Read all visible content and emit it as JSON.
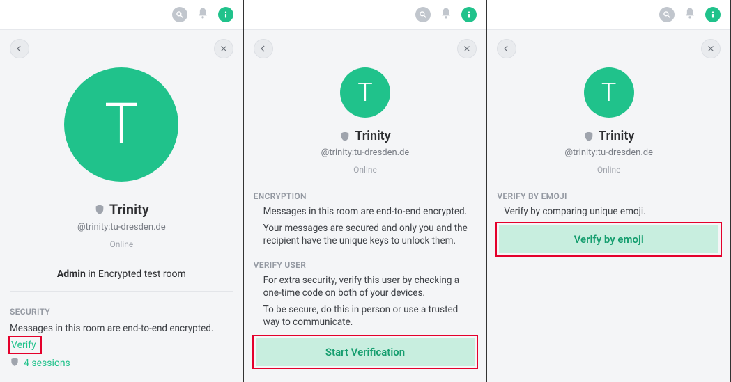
{
  "common": {
    "avatar_letter": "T",
    "display_name": "Trinity",
    "handle": "@trinity:tu-dresden.de",
    "status": "Online"
  },
  "panel1": {
    "role_strong": "Admin",
    "role_rest": " in Encrypted test room",
    "security_label": "SECURITY",
    "encrypted_msg": "Messages in this room are end-to-end encrypted.",
    "verify_link": "Verify",
    "sessions_link": "4 sessions"
  },
  "panel2": {
    "encryption_label": "ENCRYPTION",
    "encryption_text1": "Messages in this room are end-to-end encrypted.",
    "encryption_text2": "Your messages are secured and only you and the recipient have the unique keys to unlock them.",
    "verify_user_label": "VERIFY USER",
    "verify_user_text1": "For extra security, verify this user by checking a one-time code on both of your devices.",
    "verify_user_text2": "To be secure, do this in person or use a trusted way to communicate.",
    "start_verification_btn": "Start Verification"
  },
  "panel3": {
    "verify_emoji_label": "VERIFY BY EMOJI",
    "verify_emoji_text": "Verify by comparing unique emoji.",
    "verify_emoji_btn": "Verify by emoji"
  }
}
